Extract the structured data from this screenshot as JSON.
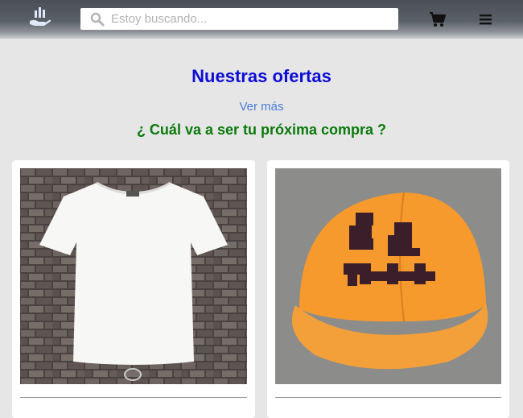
{
  "header": {
    "logo_icon": "hand-with-bars-logo-icon",
    "search": {
      "placeholder": "Estoy buscando...",
      "value": "",
      "icon": "search-icon"
    },
    "cart_icon": "shopping-cart-icon",
    "menu_icon": "hamburger-menu-icon"
  },
  "main": {
    "title": "Nuestras ofertas",
    "see_more": "Ver más",
    "subtitle": "¿ Cuál va a ser tu próxima compra ?"
  },
  "products": [
    {
      "image": "white-t-shirt-on-brick-wall"
    },
    {
      "image": "orange-cap-pumpkin-face"
    }
  ],
  "colors": {
    "title": "#0d0dd6",
    "link": "#4a7bd8",
    "subtitle": "#0a7a0a",
    "background": "#e6e6e6"
  }
}
